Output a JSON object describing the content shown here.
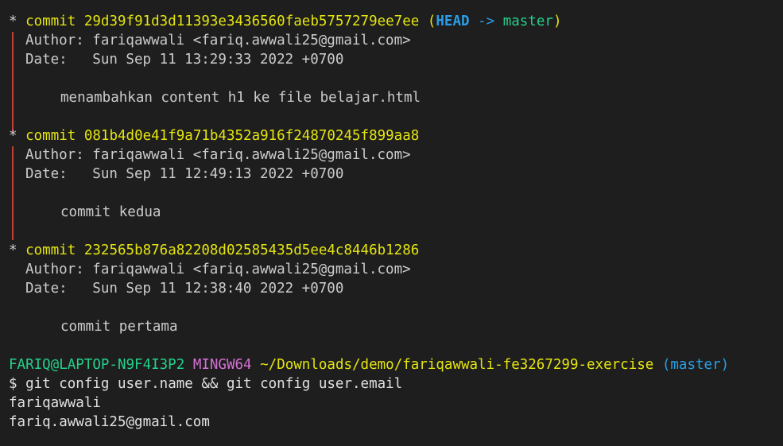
{
  "colors": {
    "background": "#1e1e1e",
    "text": "#cccccc",
    "commit_yellow": "#e5e510",
    "head_blue": "#2a9ee6",
    "branch_green": "#23d18b",
    "graph_red": "#c24038",
    "mingw_magenta": "#d670d6"
  },
  "log": {
    "commits": [
      {
        "star": "*",
        "keyword": "commit",
        "hash": "29d39f91d3d11393e3436560faeb5757279ee7ee",
        "ref_open": "(",
        "head": "HEAD",
        "arrow": "->",
        "branch": "master",
        "ref_close": ")",
        "author_line": "Author: fariqawwali <fariq.awwali25@gmail.com>",
        "date_line": "Date:   Sun Sep 11 13:29:33 2022 +0700",
        "message": "menambahkan content h1 ke file belajar.html"
      },
      {
        "star": "*",
        "keyword": "commit",
        "hash": "081b4d0e41f9a71b4352a916f24870245f899aa8",
        "author_line": "Author: fariqawwali <fariq.awwali25@gmail.com>",
        "date_line": "Date:   Sun Sep 11 12:49:13 2022 +0700",
        "message": "commit kedua"
      },
      {
        "star": "*",
        "keyword": "commit",
        "hash": "232565b876a82208d02585435d5ee4c8446b1286",
        "author_line": "Author: fariqawwali <fariq.awwali25@gmail.com>",
        "date_line": "Date:   Sun Sep 11 12:38:40 2022 +0700",
        "message": "commit pertama"
      }
    ]
  },
  "prompt": {
    "user_host": "FARIQ@LAPTOP-N9F4I3P2",
    "env": "MINGW64",
    "path": "~/Downloads/demo/fariqawwali-fe3267299-exercise",
    "branch": "(master)",
    "symbol": "$",
    "command": "git config user.name && git config user.email"
  },
  "output": {
    "lines": [
      "fariqawwali",
      "fariq.awwali25@gmail.com"
    ]
  }
}
